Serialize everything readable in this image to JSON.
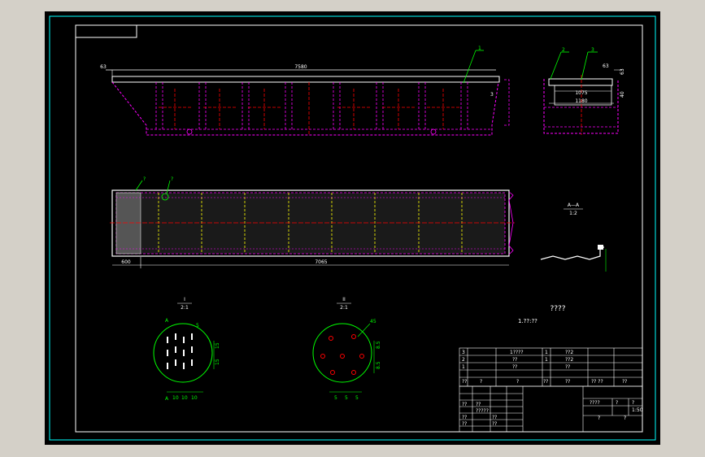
{
  "colors": {
    "background": "#d4d0c8",
    "sheet": "#000000",
    "frame": "#00ffff",
    "outline": "#ffffff",
    "magenta": "#ff00ff",
    "green": "#00ff00",
    "red": "#ff0000",
    "yellow": "#ffff00"
  },
  "top_view": {
    "dim_total": "7580",
    "dim_left": "63",
    "balloon_1": "1"
  },
  "side_view": {
    "balloon_2": "2",
    "balloon_3": "3",
    "dim_63": "63",
    "dim_1075": "1075",
    "dim_1180": "1180",
    "dim_40": "40",
    "dim_right": "63"
  },
  "plan_view": {
    "dim_600": "600",
    "dim_7065": "7065",
    "balloon_a": "?",
    "balloon_b": "?"
  },
  "section_aa": {
    "title": "A—A",
    "scale": "1:2"
  },
  "detail_1": {
    "title": "I",
    "scale": "2:1",
    "dims": [
      "10",
      "10",
      "10",
      "15",
      "15",
      "5"
    ],
    "marker": "A"
  },
  "detail_2": {
    "title": "II",
    "scale": "2:1",
    "dims": [
      "5",
      "5",
      "5",
      "8.5",
      "8.5",
      "45"
    ]
  },
  "notes": {
    "heading": "????",
    "line": "1.??:??"
  },
  "parts_table": {
    "rows": [
      [
        "3",
        "",
        "1????",
        "1",
        "??2",
        "",
        ""
      ],
      [
        "2",
        "",
        "??",
        "1",
        "??2",
        "",
        ""
      ],
      [
        "1",
        "",
        "??",
        "",
        "??",
        "",
        ""
      ],
      [
        "??",
        "?",
        "?",
        "??",
        "??",
        "?? ??",
        "??"
      ]
    ]
  },
  "title_block": {
    "left_cells": [
      "??",
      "??",
      "?????",
      "??",
      "??",
      "??",
      "??"
    ],
    "right_cells": [
      "????",
      "?",
      "?",
      "1:50",
      "?",
      "?"
    ]
  }
}
